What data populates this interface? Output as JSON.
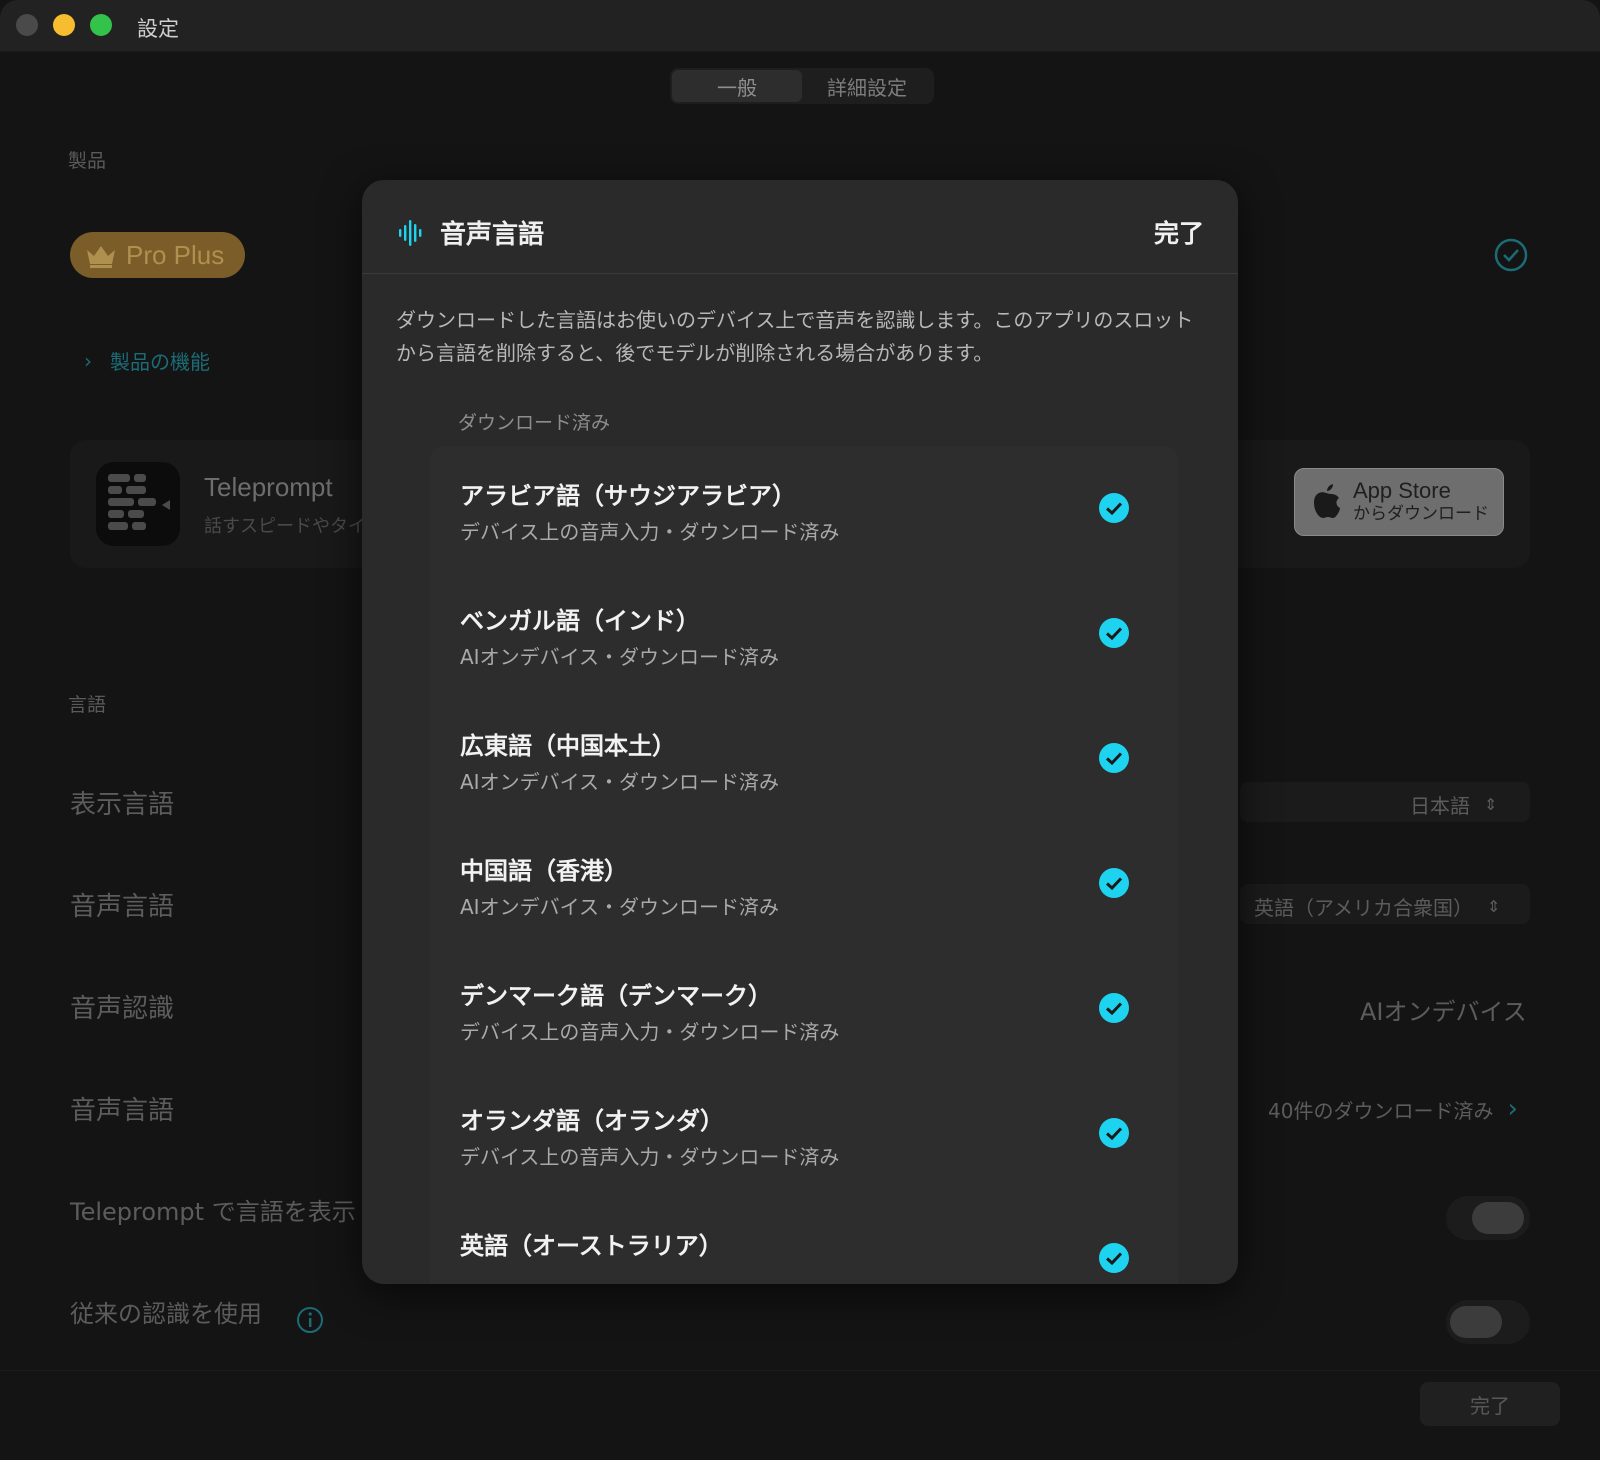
{
  "window": {
    "title": "設定"
  },
  "tabs": [
    {
      "label": "一般",
      "active": true
    },
    {
      "label": "詳細設定",
      "active": false
    }
  ],
  "product": {
    "section_label": "製品",
    "badge": "Pro Plus",
    "features_link": "製品の機能"
  },
  "app": {
    "name": "Teleprompter",
    "name_visible": "Teleprompt",
    "subtitle": "話すスピードやタイ",
    "appstore_line1": "App Store",
    "appstore_line2": "からダウンロード"
  },
  "language_section": {
    "label": "言語",
    "rows": [
      {
        "label": "表示言語",
        "value": "日本語"
      },
      {
        "label": "音声言語",
        "value": "英語（アメリカ合衆国）"
      },
      {
        "label": "音声認識",
        "value": "AIオンデバイス"
      },
      {
        "label": "音声言語",
        "value": "40件のダウンロード済み"
      },
      {
        "label": "Teleprompt で言語を表示"
      },
      {
        "label": "従来の認識を使用"
      }
    ]
  },
  "footer": {
    "done": "完了"
  },
  "sheet": {
    "title": "音声言語",
    "done": "完了",
    "description": "ダウンロードした言語はお使いのデバイス上で音声を認識します。このアプリのスロットから言語を削除すると、後でモデルが削除される場合があります。",
    "list_header": "ダウンロード済み",
    "languages": [
      {
        "name": "アラビア語（サウジアラビア）",
        "status": "デバイス上の音声入力・ダウンロード済み"
      },
      {
        "name": "ベンガル語（インド）",
        "status": "AIオンデバイス・ダウンロード済み"
      },
      {
        "name": "広東語（中国本土）",
        "status": "AIオンデバイス・ダウンロード済み"
      },
      {
        "name": "中国語（香港）",
        "status": "AIオンデバイス・ダウンロード済み"
      },
      {
        "name": "デンマーク語（デンマーク）",
        "status": "デバイス上の音声入力・ダウンロード済み"
      },
      {
        "name": "オランダ語（オランダ）",
        "status": "デバイス上の音声入力・ダウンロード済み"
      },
      {
        "name": "英語（オーストラリア）",
        "status": ""
      }
    ]
  },
  "colors": {
    "accent": "#1ed3f0",
    "sheet_bg": "#2a2a2b",
    "window_bg": "#141414"
  }
}
